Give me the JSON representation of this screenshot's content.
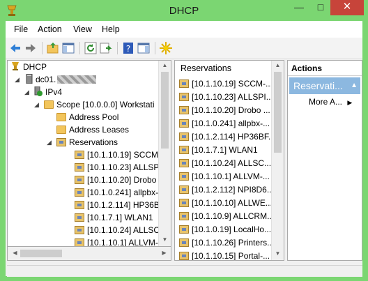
{
  "window": {
    "title": "DHCP"
  },
  "menu": [
    "File",
    "Action",
    "View",
    "Help"
  ],
  "tree": {
    "root": "DHCP",
    "server": "dc01.",
    "ipv4": "IPv4",
    "scope": "Scope [10.0.0.0] Workstati",
    "address_pool": "Address Pool",
    "address_leases": "Address Leases",
    "reservations": "Reservations",
    "items": [
      "[10.1.10.19] SCCM-",
      "[10.1.10.23] ALLSPI",
      "[10.1.10.20] Drobo",
      "[10.1.0.241] allpbx-",
      "[10.1.2.114] HP36B",
      "[10.1.7.1] WLAN1",
      "[10.1.10.24] ALLSCI",
      "[10.1.10.1] ALLVM-"
    ]
  },
  "list": {
    "header": "Reservations",
    "items": [
      "[10.1.10.19] SCCM-...",
      "[10.1.10.23] ALLSPI...",
      "[10.1.10.20] Drobo ...",
      "[10.1.0.241] allpbx-...",
      "[10.1.2.114] HP36BF...",
      "[10.1.7.1] WLAN1",
      "[10.1.10.24] ALLSC...",
      "[10.1.10.1] ALLVM-...",
      "[10.1.2.112] NPI8D6...",
      "[10.1.10.10] ALLWE...",
      "[10.1.10.9] ALLCRM...",
      "[10.1.0.19] LocalHo...",
      "[10.1.10.26] Printers...",
      "[10.1.10.15] Portal-..."
    ]
  },
  "actions": {
    "header": "Actions",
    "section": "Reservati...",
    "more": "More A..."
  },
  "icons": {
    "back": "back-arrow-icon",
    "forward": "forward-arrow-icon",
    "up": "up-folder-icon",
    "show_tree": "show-hide-tree-icon",
    "refresh": "refresh-icon",
    "export": "export-list-icon",
    "help": "help-icon",
    "show_action": "show-hide-action-pane-icon",
    "new": "star-burst-icon"
  },
  "colors": {
    "frame": "#7bd672",
    "close": "#c7443a",
    "selection": "#8cb8e0"
  }
}
